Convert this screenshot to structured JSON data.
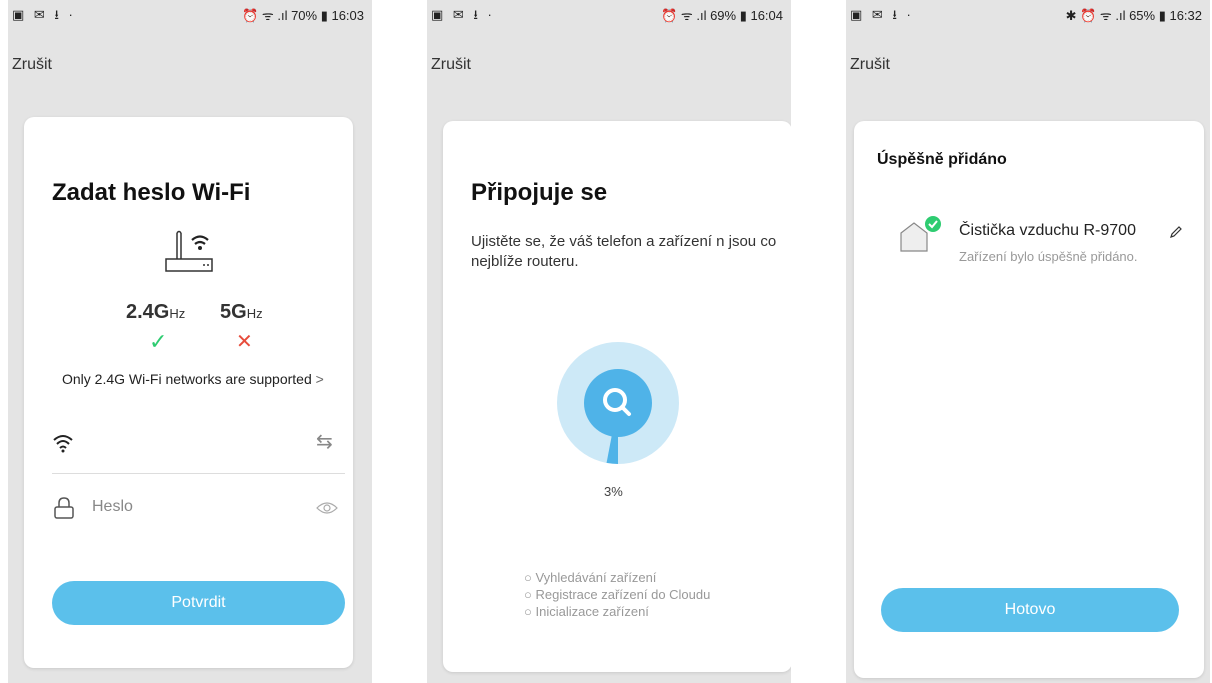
{
  "screens": [
    {
      "status": {
        "left": "▣ ✉ ⭳ ·",
        "right": "⏰ ᯤ .ıl 70% ▮ 16:03"
      },
      "cancel": "Zrušit",
      "title": "Zadat heslo Wi-Fi",
      "band_24": {
        "num": "2.4G",
        "unit": "Hz"
      },
      "band_5": {
        "num": "5G",
        "unit": "Hz"
      },
      "check_mark": "✓",
      "cross_mark": "✕",
      "support_text": "Only 2.4G Wi-Fi networks are supported",
      "support_chevron": ">",
      "switch_glyph": "⇆",
      "password_placeholder": "Heslo",
      "confirm_button": "Potvrdit"
    },
    {
      "status": {
        "left": "▣ ✉ ⭳ ·",
        "right": "⏰ ᯤ .ıl 69% ▮ 16:04"
      },
      "cancel": "Zrušit",
      "title": "Připojuje se",
      "subtitle": "Ujistěte se, že váš telefon a zařízení  n jsou co nejblíže routeru.",
      "progress_text": "3%",
      "progress_value": 3,
      "steps": [
        "Vyhledávání zařízení",
        "Registrace zařízení do Cloudu",
        "Inicializace zařízení"
      ]
    },
    {
      "status": {
        "left": "▣ ✉ ⭳ ·",
        "right": "✱ ⏰ ᯤ .ıl 65% ▮ 16:32"
      },
      "cancel": "Zrušit",
      "title": "Úspěšně přidáno",
      "device_name": "Čistička vzduchu R-9700",
      "device_status": "Zařízení bylo úspěšně přidáno.",
      "done_button": "Hotovo"
    }
  ],
  "colors": {
    "accent": "#5bc0eb",
    "success": "#2ecc71",
    "error": "#e74c3c",
    "progress_ring": "#4fb3e8"
  }
}
